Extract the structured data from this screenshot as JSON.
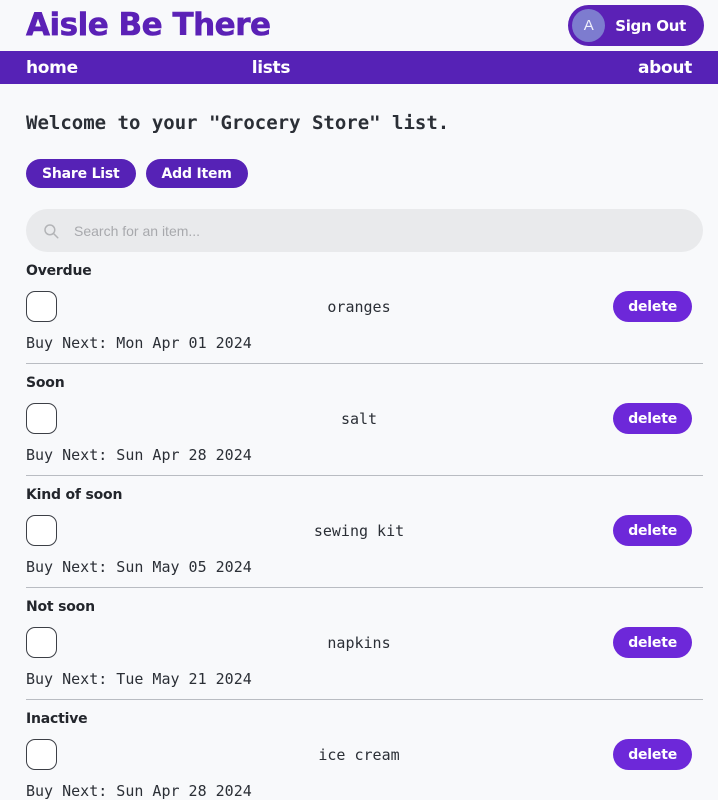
{
  "header": {
    "brand": "Aisle Be There",
    "avatar_initial": "A",
    "signout_label": "Sign Out",
    "brand_color": "#5b21b6"
  },
  "nav": {
    "items": [
      {
        "label": "home",
        "align": "left"
      },
      {
        "label": "lists",
        "align": "center"
      },
      {
        "label": "about",
        "align": "right"
      }
    ],
    "background_color": "#5622b6"
  },
  "main": {
    "welcome": "Welcome to your \"Grocery Store\" list.",
    "buttons": [
      {
        "label": "Share List",
        "name": "share-list-button"
      },
      {
        "label": "Add Item",
        "name": "add-item-button"
      }
    ],
    "search": {
      "placeholder": "Search for an item...",
      "value": ""
    },
    "groups": [
      {
        "label": "Overdue",
        "item_name": "oranges",
        "buy_next": "Buy Next: Mon Apr 01 2024",
        "delete_label": "delete",
        "checked": false
      },
      {
        "label": "Soon",
        "item_name": "salt",
        "buy_next": "Buy Next: Sun Apr 28 2024",
        "delete_label": "delete",
        "checked": false
      },
      {
        "label": "Kind of soon",
        "item_name": "sewing kit",
        "buy_next": "Buy Next: Sun May 05 2024",
        "delete_label": "delete",
        "checked": false
      },
      {
        "label": "Not soon",
        "item_name": "napkins",
        "buy_next": "Buy Next: Tue May 21 2024",
        "delete_label": "delete",
        "checked": false
      },
      {
        "label": "Inactive",
        "item_name": "ice cream",
        "buy_next": "Buy Next: Sun Apr 28 2024",
        "delete_label": "delete",
        "checked": false
      }
    ]
  },
  "colors": {
    "accent": "#5622b6",
    "accent_light": "#6d28d9",
    "avatar": "#7d7ccf",
    "page_background": "#f8f9fb",
    "search_background": "#e9eaec"
  }
}
